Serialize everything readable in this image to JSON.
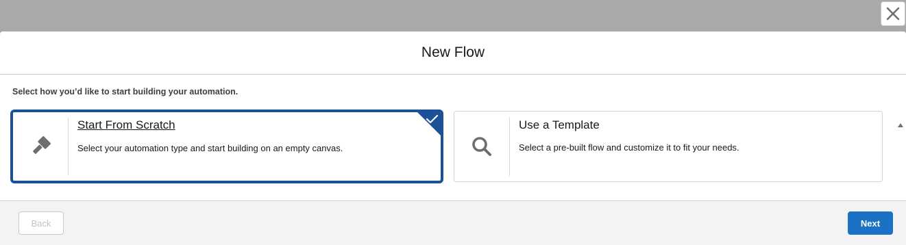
{
  "modal": {
    "title": "New Flow",
    "instructions": "Select how you’d like to start building your automation."
  },
  "options": [
    {
      "title": "Start From Scratch",
      "description": "Select your automation type and start building on an empty canvas.",
      "icon": "hammer-icon",
      "selected": true
    },
    {
      "title": "Use a Template",
      "description": "Select a pre-built flow and customize it to fit your needs.",
      "icon": "search-icon",
      "selected": false
    }
  ],
  "footer": {
    "back_label": "Back",
    "next_label": "Next"
  },
  "colors": {
    "selected_border": "#1b5297",
    "primary_button": "#1b72c4",
    "overlay": "#a9a9a9",
    "icon_gray": "#706e6b"
  }
}
